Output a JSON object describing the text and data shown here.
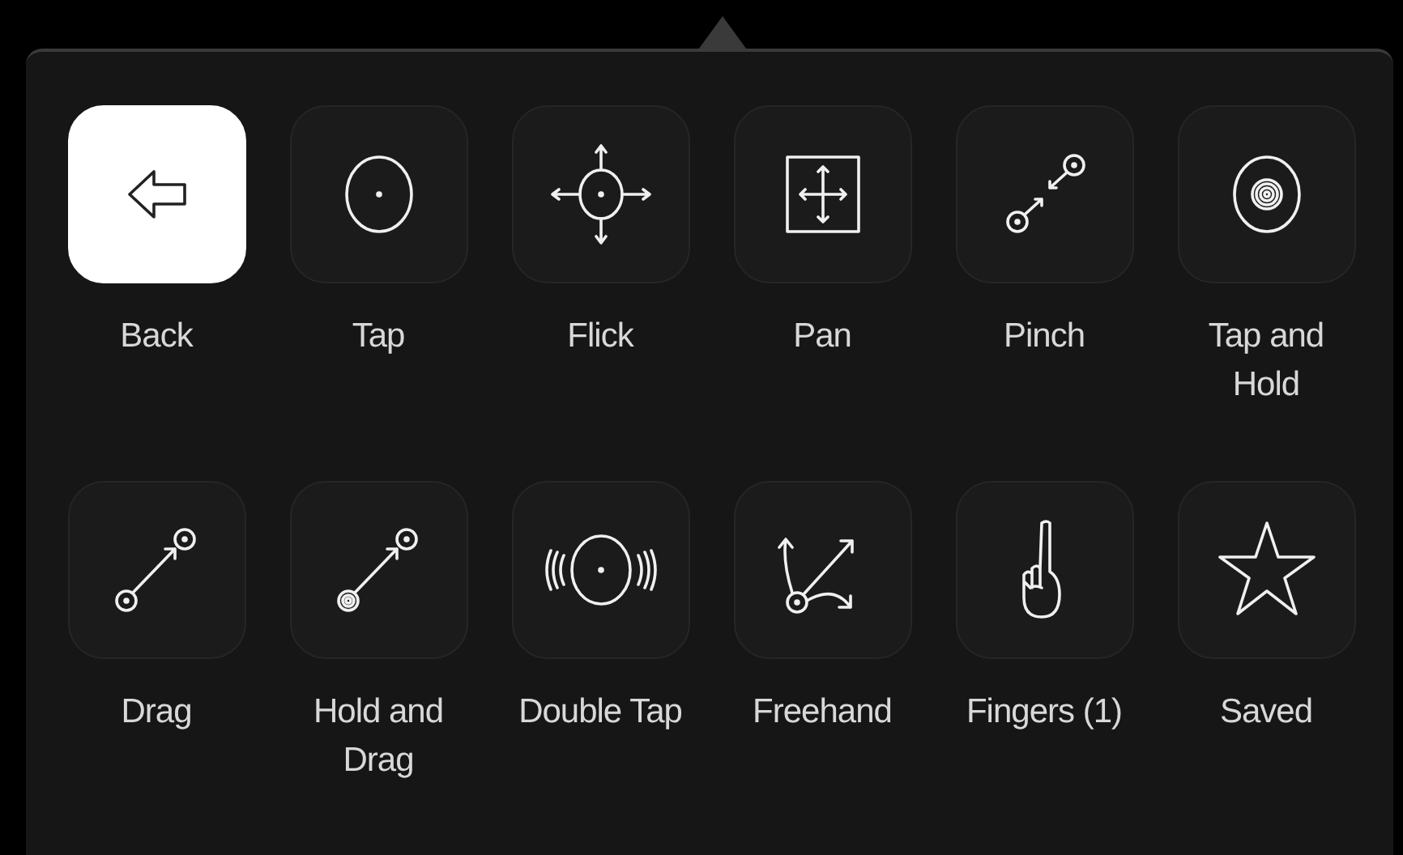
{
  "gestures": [
    {
      "label": "Back",
      "kind": "back",
      "selected": true
    },
    {
      "label": "Tap",
      "kind": "tap",
      "selected": false
    },
    {
      "label": "Flick",
      "kind": "flick",
      "selected": false
    },
    {
      "label": "Pan",
      "kind": "pan",
      "selected": false
    },
    {
      "label": "Pinch",
      "kind": "pinch",
      "selected": false
    },
    {
      "label": "Tap and Hold",
      "kind": "hold",
      "selected": false
    },
    {
      "label": "Drag",
      "kind": "drag",
      "selected": false
    },
    {
      "label": "Hold and Drag",
      "kind": "holddrag",
      "selected": false
    },
    {
      "label": "Double Tap",
      "kind": "doubletap",
      "selected": false
    },
    {
      "label": "Freehand",
      "kind": "freehand",
      "selected": false
    },
    {
      "label": "Fingers (1)",
      "kind": "fingers",
      "selected": false
    },
    {
      "label": "Saved",
      "kind": "saved",
      "selected": false
    }
  ]
}
